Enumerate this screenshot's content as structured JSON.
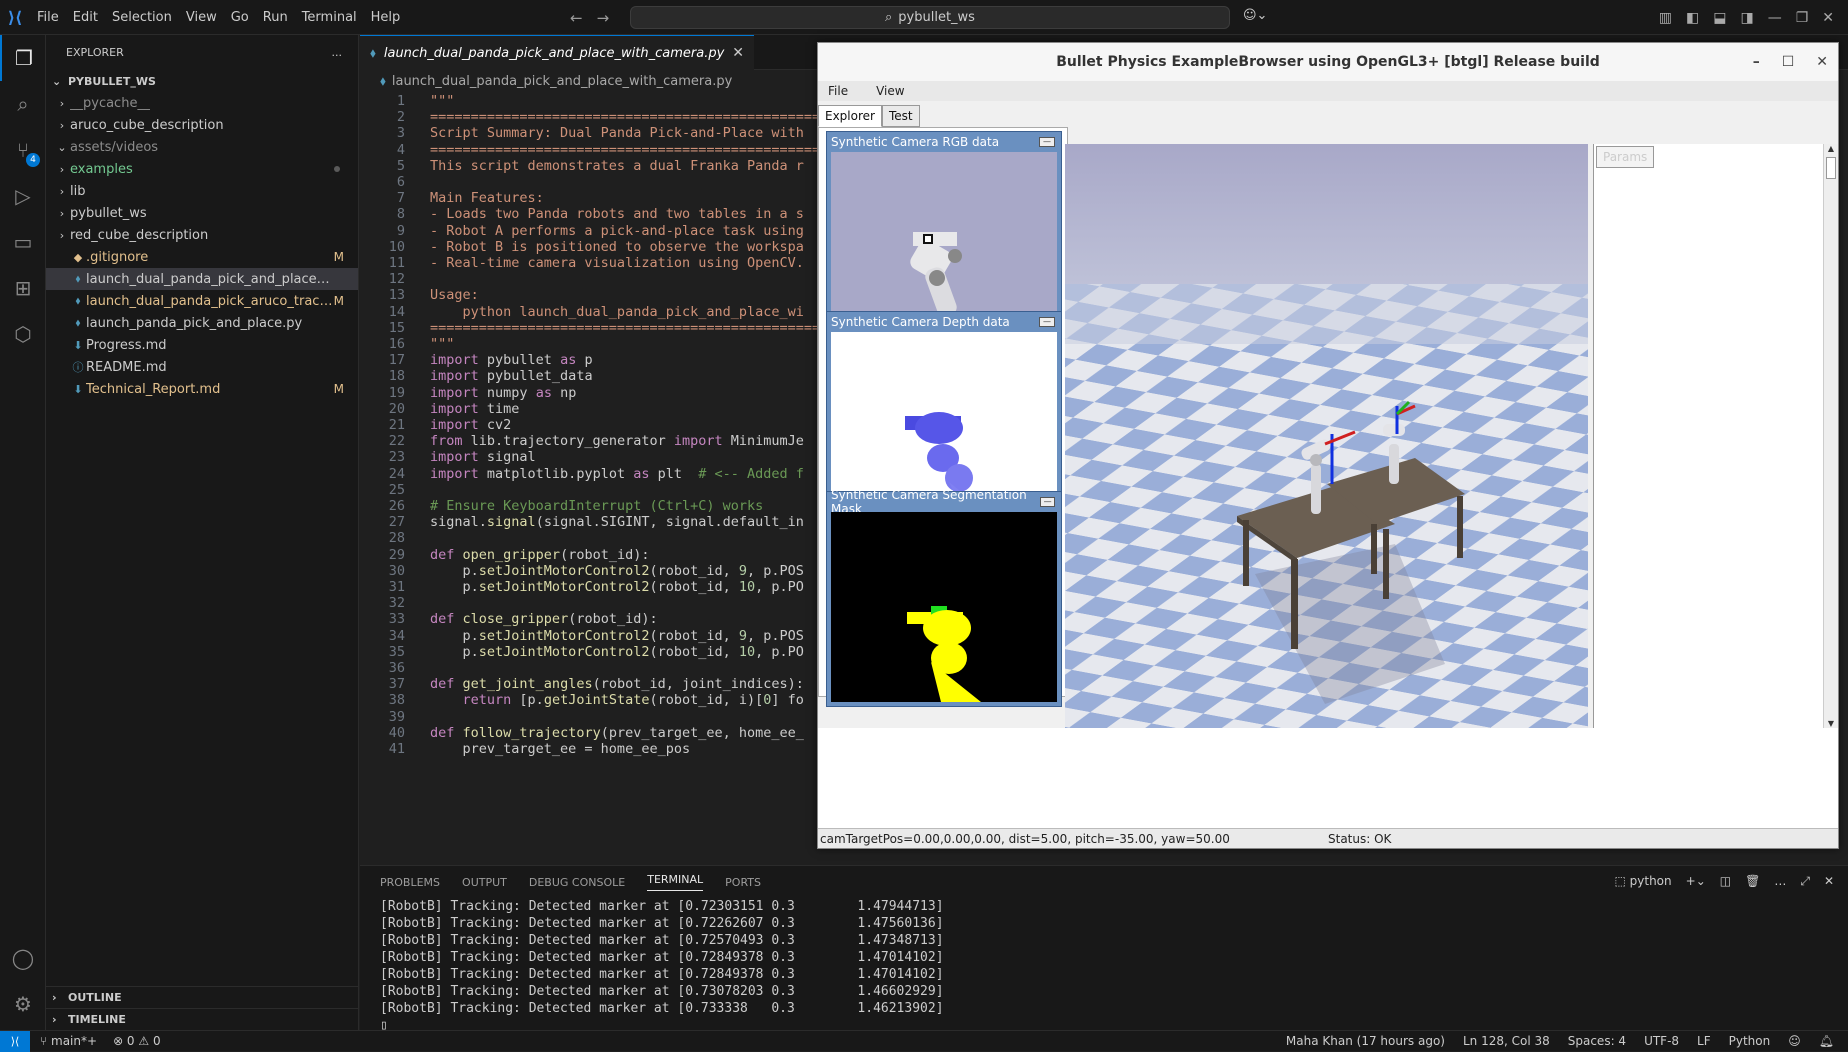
{
  "menu": {
    "items": [
      "File",
      "Edit",
      "Selection",
      "View",
      "Go",
      "Run",
      "Terminal",
      "Help"
    ]
  },
  "command_center": {
    "text": "pybullet_ws"
  },
  "explorer": {
    "title": "EXPLORER",
    "more": "...",
    "root": "PYBULLET_WS",
    "items": [
      {
        "label": "__pycache__",
        "type": "folder",
        "color": "#8c8c8c"
      },
      {
        "label": "aruco_cube_description",
        "type": "folder",
        "color": "#cccccc"
      },
      {
        "label": "assets/videos",
        "type": "folder-open",
        "color": "#8c8c8c"
      },
      {
        "label": "examples",
        "type": "folder",
        "color": "#73c991",
        "dot": true
      },
      {
        "label": "lib",
        "type": "folder",
        "color": "#cccccc"
      },
      {
        "label": "pybullet_ws",
        "type": "folder",
        "color": "#cccccc"
      },
      {
        "label": "red_cube_description",
        "type": "folder",
        "color": "#cccccc"
      },
      {
        "label": ".gitignore",
        "type": "file",
        "color": "#e2c08d",
        "mark": "M"
      },
      {
        "label": "launch_dual_panda_pick_and_place_with_ca...",
        "type": "py",
        "color": "#cccccc",
        "selected": true
      },
      {
        "label": "launch_dual_panda_pick_aruco_track.py",
        "type": "py",
        "color": "#e2c08d",
        "mark": "M"
      },
      {
        "label": "launch_panda_pick_and_place.py",
        "type": "py",
        "color": "#cccccc"
      },
      {
        "label": "Progress.md",
        "type": "md",
        "color": "#cccccc"
      },
      {
        "label": "README.md",
        "type": "info",
        "color": "#cccccc"
      },
      {
        "label": "Technical_Report.md",
        "type": "md",
        "color": "#e2c08d",
        "mark": "M"
      }
    ],
    "outline": "OUTLINE",
    "timeline": "TIMELINE"
  },
  "editor": {
    "tab_label": "launch_dual_panda_pick_and_place_with_camera.py",
    "breadcrumb": "launch_dual_panda_pick_and_place_with_camera.py",
    "lines": [
      "\"\"\"",
      "============================================================================",
      "Script Summary: Dual Panda Pick-and-Place with",
      "============================================================================",
      "This script demonstrates a dual Franka Panda r",
      "",
      "Main Features:",
      "- Loads two Panda robots and two tables in a s",
      "- Robot A performs a pick-and-place task using",
      "- Robot B is positioned to observe the workspa",
      "- Real-time camera visualization using OpenCV.",
      "",
      "Usage:",
      "    python launch_dual_panda_pick_and_place_wi",
      "============================================================================",
      "\"\"\"",
      "import pybullet as p",
      "import pybullet_data",
      "import numpy as np",
      "import time",
      "import cv2",
      "from lib.trajectory_generator import MinimumJe",
      "import signal",
      "import matplotlib.pyplot as plt  # <-- Added f",
      "",
      "# Ensure KeyboardInterrupt (Ctrl+C) works",
      "signal.signal(signal.SIGINT, signal.default_in",
      "",
      "def open_gripper(robot_id):",
      "    p.setJointMotorControl2(robot_id, 9, p.POS",
      "    p.setJointMotorControl2(robot_id, 10, p.PO",
      "",
      "def close_gripper(robot_id):",
      "    p.setJointMotorControl2(robot_id, 9, p.POS",
      "    p.setJointMotorControl2(robot_id, 10, p.PO",
      "",
      "def get_joint_angles(robot_id, joint_indices):",
      "    return [p.getJointState(robot_id, i)[0] fo",
      "",
      "def follow_trajectory(prev_target_ee, home_ee_",
      "    prev_target_ee = home_ee_pos"
    ]
  },
  "panel": {
    "tabs": [
      "PROBLEMS",
      "OUTPUT",
      "DEBUG CONSOLE",
      "TERMINAL",
      "PORTS"
    ],
    "active_tab": "TERMINAL",
    "shell": "python",
    "terminal_lines": [
      "[RobotB] Tracking: Detected marker at [0.72303151 0.3        1.47944713]",
      "[RobotB] Tracking: Detected marker at [0.72262607 0.3        1.47560136]",
      "[RobotB] Tracking: Detected marker at [0.72570493 0.3        1.47348713]",
      "[RobotB] Tracking: Detected marker at [0.72849378 0.3        1.47014102]",
      "[RobotB] Tracking: Detected marker at [0.72849378 0.3        1.47014102]",
      "[RobotB] Tracking: Detected marker at [0.73078203 0.3        1.46602929]",
      "[RobotB] Tracking: Detected marker at [0.733338   0.3        1.46213902]"
    ]
  },
  "statusbar": {
    "branch": "main*+",
    "problems": "⊗ 0 ⚠ 0",
    "blame": "Maha Khan (17 hours ago)",
    "position": "Ln 128, Col 38",
    "spaces": "Spaces: 4",
    "encoding": "UTF-8",
    "eol": "LF",
    "language": "Python"
  },
  "bullet": {
    "title": "Bullet Physics ExampleBrowser using OpenGL3+ [btgl] Release build",
    "menu": [
      "File",
      "View"
    ],
    "tabs": [
      "Explorer",
      "Test"
    ],
    "params_tab": "Params",
    "cam_rgb": "Synthetic Camera RGB data",
    "cam_depth": "Synthetic Camera Depth data",
    "cam_seg": "Synthetic Camera Segmentation Mask",
    "status_left": "camTargetPos=0.00,0.00,0.00, dist=5.00, pitch=-35.00, yaw=50.00",
    "status_right": "Status: OK"
  }
}
